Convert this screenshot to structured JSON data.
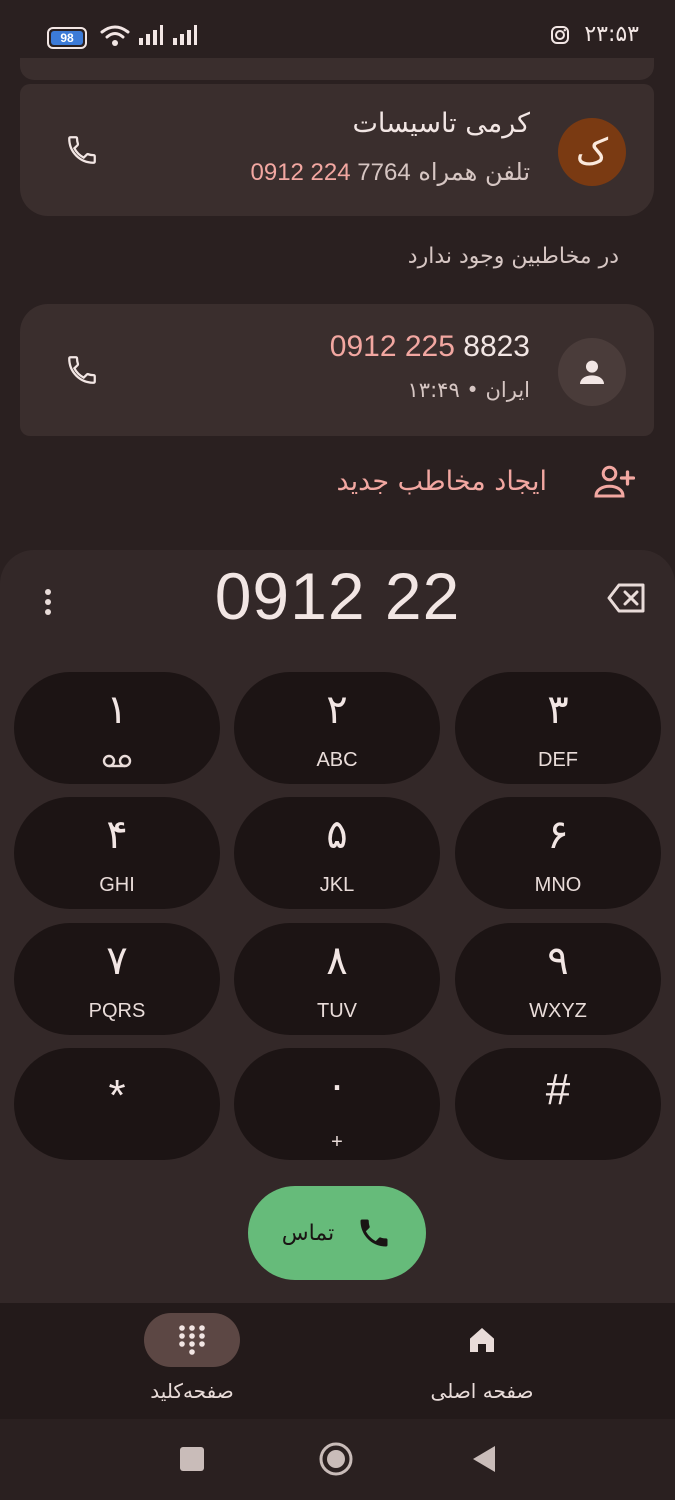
{
  "status_bar": {
    "battery_level": "98",
    "time": "۲۳:۵۳",
    "icons": [
      "wifi-icon",
      "signal-icon",
      "signal-icon",
      "instagram-icon"
    ]
  },
  "results": {
    "contact": {
      "avatar_letter": "ک",
      "name": "کرمی تاسیسات",
      "phone_type": "تلفن همراه",
      "phone_match": "0912 224",
      "phone_rest": " 7764"
    },
    "not_in_contacts_label": "در مخاطبین وجود ندارد",
    "unknown": {
      "number_match": "0912 225",
      "number_rest": " 8823",
      "detail": "ایران • ۱۳:۴۹"
    },
    "create_contact_label": "ایجاد مخاطب جدید"
  },
  "dialpad": {
    "entered_number": "0912 22",
    "keys": [
      {
        "digit": "۱",
        "letters": ""
      },
      {
        "digit": "۲",
        "letters": "ABC"
      },
      {
        "digit": "۳",
        "letters": "DEF"
      },
      {
        "digit": "۴",
        "letters": "GHI"
      },
      {
        "digit": "۵",
        "letters": "JKL"
      },
      {
        "digit": "۶",
        "letters": "MNO"
      },
      {
        "digit": "۷",
        "letters": "PQRS"
      },
      {
        "digit": "۸",
        "letters": "TUV"
      },
      {
        "digit": "۹",
        "letters": "WXYZ"
      },
      {
        "digit": "*",
        "letters": ""
      },
      {
        "digit": "۰",
        "letters": "+"
      },
      {
        "digit": "#",
        "letters": ""
      }
    ],
    "call_label": "تماس"
  },
  "bottom_nav": {
    "keypad_label": "صفحه‌کلید",
    "home_label": "صفحه اصلی"
  },
  "colors": {
    "background": "#2a2020",
    "card": "#3a2e2d",
    "key": "#1c1414",
    "accent": "#f2a7a1",
    "call_green": "#66bb7a"
  }
}
